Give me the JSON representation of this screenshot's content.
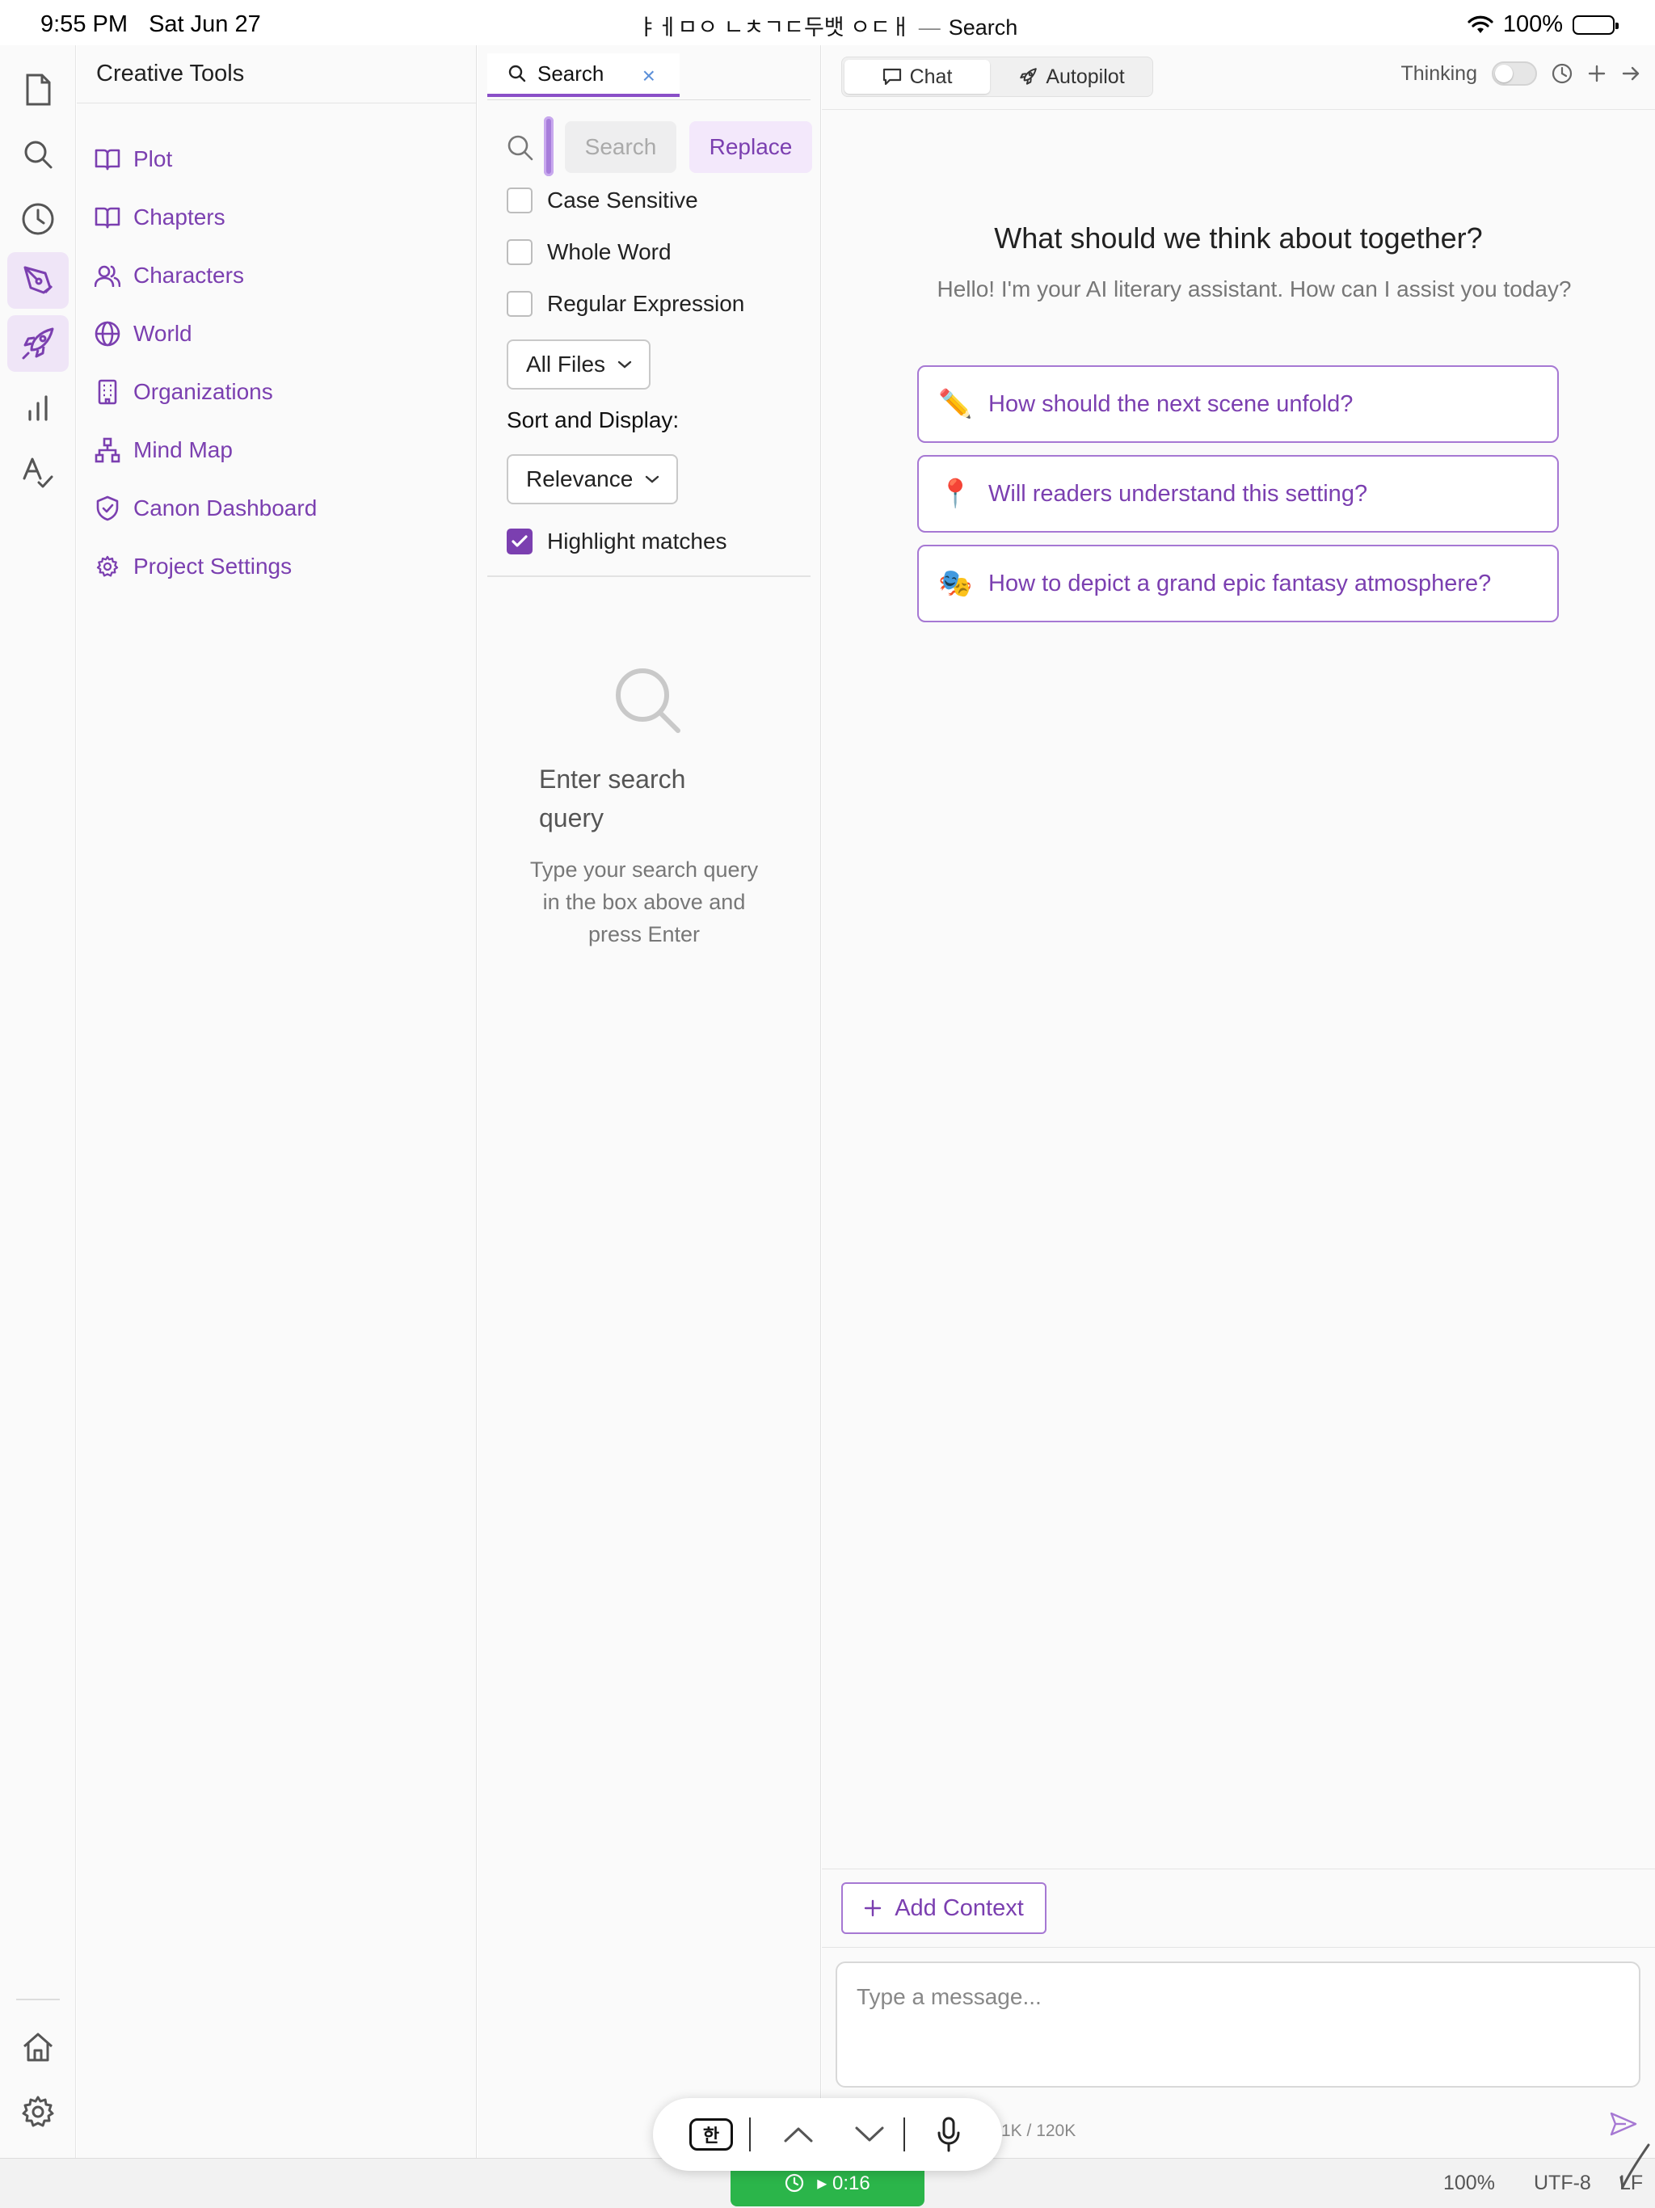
{
  "status_bar": {
    "time": "9:55 PM",
    "date": "Sat Jun 27",
    "window_title_prefix": "ㅑㅔㅁㅇ ㄴㅊㄱㄷ두뱃 ㅇㄷㅐ",
    "window_title_separator": "—",
    "window_title": "Search",
    "battery_percent": "100%"
  },
  "rail": {
    "icons": [
      "file-icon",
      "search-icon",
      "clock-icon",
      "pen-nib-icon",
      "rocket-icon",
      "bar-chart-icon",
      "spellcheck-icon",
      "home-icon",
      "settings-gear-icon"
    ],
    "active": [
      "pen-nib-icon",
      "rocket-icon"
    ]
  },
  "tools": {
    "header": "Creative Tools",
    "items": [
      {
        "label": "Plot",
        "icon": "book-icon"
      },
      {
        "label": "Chapters",
        "icon": "book-icon"
      },
      {
        "label": "Characters",
        "icon": "users-icon"
      },
      {
        "label": "World",
        "icon": "globe-icon"
      },
      {
        "label": "Organizations",
        "icon": "building-icon"
      },
      {
        "label": "Mind Map",
        "icon": "network-icon"
      },
      {
        "label": "Canon Dashboard",
        "icon": "shield-check-icon"
      },
      {
        "label": "Project Settings",
        "icon": "gear-icon"
      }
    ]
  },
  "search": {
    "tab_label": "Search",
    "close_symbol": "×",
    "search_button": "Search",
    "replace_button": "Replace",
    "options": [
      {
        "label": "Case Sensitive",
        "checked": false
      },
      {
        "label": "Whole Word",
        "checked": false
      },
      {
        "label": "Regular Expression",
        "checked": false
      }
    ],
    "scope_dropdown": "All Files",
    "sort_label": "Sort and Display:",
    "sort_dropdown": "Relevance",
    "highlight": {
      "label": "Highlight matches",
      "checked": true
    },
    "empty_title": "Enter search query",
    "empty_desc": "Type your search query in the box above and press Enter"
  },
  "chat": {
    "tabs": [
      {
        "label": "Chat",
        "icon": "chat-bubble-icon",
        "active": true
      },
      {
        "label": "Autopilot",
        "icon": "rocket-icon",
        "active": false
      }
    ],
    "thinking_label": "Thinking",
    "thinking_on": false,
    "welcome_title": "What should we think about together?",
    "welcome_subtitle": "Hello! I'm your AI literary assistant. How can I assist you today?",
    "suggestions": [
      {
        "emoji": "✏️",
        "text": "How should the next scene unfold?"
      },
      {
        "emoji": "📍",
        "text": "Will readers understand this setting?"
      },
      {
        "emoji": "🎭",
        "text": "How to depict a grand epic fantasy atmosphere?"
      }
    ],
    "add_context": "Add Context",
    "message_placeholder": "Type a message...",
    "token_count": "1K / 120K"
  },
  "bottom_bar": {
    "timer": "▸ 0:16",
    "zoom": "100%",
    "encoding": "UTF-8",
    "line_ending": "LF"
  },
  "keyboard_toolbar": {
    "ime_label": "한"
  },
  "colors": {
    "accent": "#7b3fb0",
    "accent_border": "#a678d3",
    "active_bg": "#efe5f7",
    "timer_green": "#2bb54a"
  }
}
